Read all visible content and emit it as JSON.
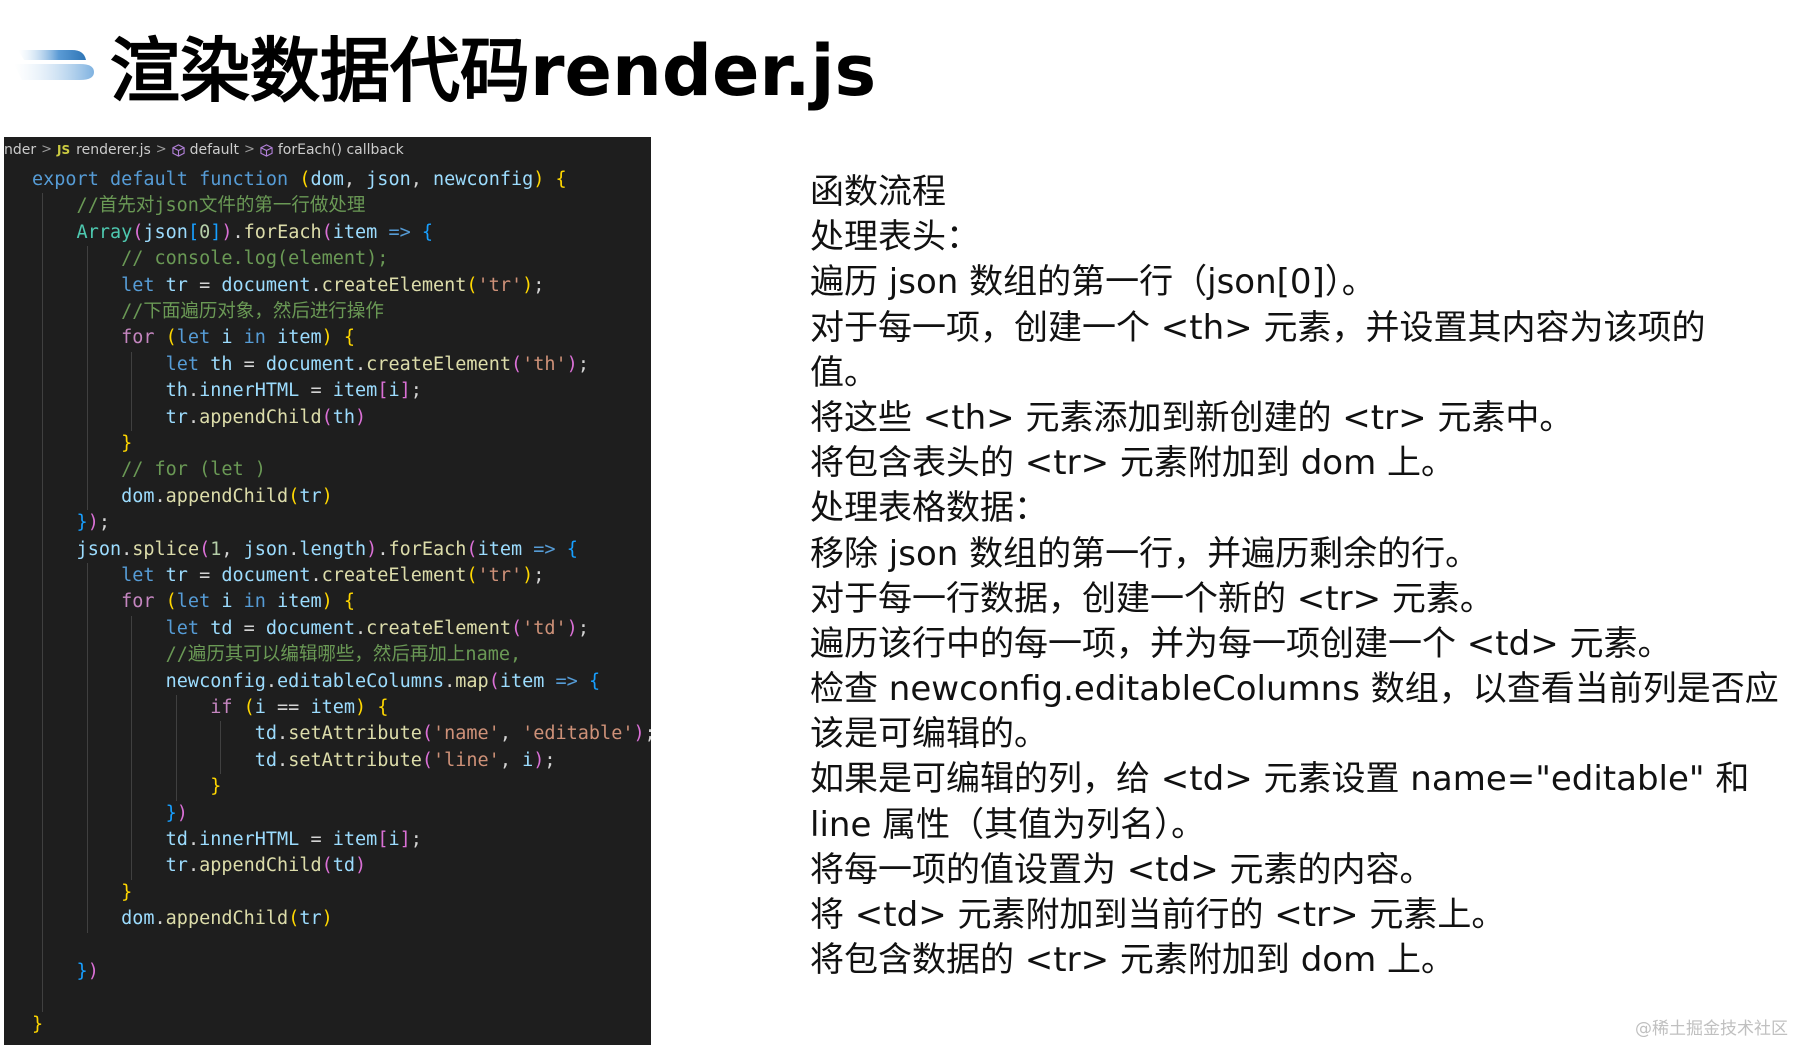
{
  "title": "渲染数据代码render.js",
  "breadcrumb": {
    "items": [
      "nder",
      "renderer.js",
      "default",
      "forEach() callback"
    ],
    "js_badge": "JS"
  },
  "code_lines": [
    [
      [
        "tk-kw",
        "export "
      ],
      [
        "tk-kw",
        "default "
      ],
      [
        "tk-kw",
        "function "
      ],
      [
        "tk-br1",
        "("
      ],
      [
        "tk-var",
        "dom"
      ],
      [
        "tk-punc",
        ", "
      ],
      [
        "tk-var",
        "json"
      ],
      [
        "tk-punc",
        ", "
      ],
      [
        "tk-var",
        "newconfig"
      ],
      [
        "tk-br1",
        ")"
      ],
      [
        "tk-punc",
        " "
      ],
      [
        "tk-br1",
        "{"
      ]
    ],
    [
      [
        "tk-com",
        "    //首先对json文件的第一行做处理"
      ]
    ],
    [
      [
        "tk-type",
        "    Array"
      ],
      [
        "tk-br2",
        "("
      ],
      [
        "tk-var",
        "json"
      ],
      [
        "tk-br3",
        "["
      ],
      [
        "tk-num",
        "0"
      ],
      [
        "tk-br3",
        "]"
      ],
      [
        "tk-br2",
        ")"
      ],
      [
        "tk-punc",
        "."
      ],
      [
        "tk-fn",
        "forEach"
      ],
      [
        "tk-br2",
        "("
      ],
      [
        "tk-var",
        "item"
      ],
      [
        "tk-kw",
        " =>"
      ],
      [
        "tk-punc",
        " "
      ],
      [
        "tk-br3",
        "{"
      ]
    ],
    [
      [
        "tk-com",
        "        // console.log(element);"
      ]
    ],
    [
      [
        "tk-kw",
        "        let "
      ],
      [
        "tk-var",
        "tr"
      ],
      [
        "tk-punc",
        " = "
      ],
      [
        "tk-var",
        "document"
      ],
      [
        "tk-punc",
        "."
      ],
      [
        "tk-fn",
        "createElement"
      ],
      [
        "tk-br1",
        "("
      ],
      [
        "tk-str",
        "'tr'"
      ],
      [
        "tk-br1",
        ")"
      ],
      [
        "tk-punc",
        ";"
      ]
    ],
    [
      [
        "tk-com",
        "        //下面遍历对象，然后进行操作"
      ]
    ],
    [
      [
        "tk-ctrl",
        "        for "
      ],
      [
        "tk-br1",
        "("
      ],
      [
        "tk-kw",
        "let "
      ],
      [
        "tk-var",
        "i"
      ],
      [
        "tk-kw",
        " in "
      ],
      [
        "tk-var",
        "item"
      ],
      [
        "tk-br1",
        ")"
      ],
      [
        "tk-punc",
        " "
      ],
      [
        "tk-br1",
        "{"
      ]
    ],
    [
      [
        "tk-kw",
        "            let "
      ],
      [
        "tk-var",
        "th"
      ],
      [
        "tk-punc",
        " = "
      ],
      [
        "tk-var",
        "document"
      ],
      [
        "tk-punc",
        "."
      ],
      [
        "tk-fn",
        "createElement"
      ],
      [
        "tk-br2",
        "("
      ],
      [
        "tk-str",
        "'th'"
      ],
      [
        "tk-br2",
        ")"
      ],
      [
        "tk-punc",
        ";"
      ]
    ],
    [
      [
        "tk-var",
        "            th"
      ],
      [
        "tk-punc",
        "."
      ],
      [
        "tk-var",
        "innerHTML"
      ],
      [
        "tk-punc",
        " = "
      ],
      [
        "tk-var",
        "item"
      ],
      [
        "tk-br2",
        "["
      ],
      [
        "tk-var",
        "i"
      ],
      [
        "tk-br2",
        "]"
      ],
      [
        "tk-punc",
        ";"
      ]
    ],
    [
      [
        "tk-var",
        "            tr"
      ],
      [
        "tk-punc",
        "."
      ],
      [
        "tk-fn",
        "appendChild"
      ],
      [
        "tk-br2",
        "("
      ],
      [
        "tk-var",
        "th"
      ],
      [
        "tk-br2",
        ")"
      ]
    ],
    [
      [
        "tk-br1",
        "        }"
      ]
    ],
    [
      [
        "tk-com",
        "        // for (let )"
      ]
    ],
    [
      [
        "tk-var",
        "        dom"
      ],
      [
        "tk-punc",
        "."
      ],
      [
        "tk-fn",
        "appendChild"
      ],
      [
        "tk-br1",
        "("
      ],
      [
        "tk-var",
        "tr"
      ],
      [
        "tk-br1",
        ")"
      ]
    ],
    [
      [
        "tk-br3",
        "    }"
      ],
      [
        "tk-br2",
        ")"
      ],
      [
        "tk-punc",
        ";"
      ]
    ],
    [
      [
        "tk-var",
        "    json"
      ],
      [
        "tk-punc",
        "."
      ],
      [
        "tk-fn",
        "splice"
      ],
      [
        "tk-br2",
        "("
      ],
      [
        "tk-num",
        "1"
      ],
      [
        "tk-punc",
        ", "
      ],
      [
        "tk-var",
        "json"
      ],
      [
        "tk-punc",
        "."
      ],
      [
        "tk-var",
        "length"
      ],
      [
        "tk-br2",
        ")"
      ],
      [
        "tk-punc",
        "."
      ],
      [
        "tk-fn",
        "forEach"
      ],
      [
        "tk-br2",
        "("
      ],
      [
        "tk-var",
        "item"
      ],
      [
        "tk-kw",
        " =>"
      ],
      [
        "tk-punc",
        " "
      ],
      [
        "tk-br3",
        "{"
      ]
    ],
    [
      [
        "tk-kw",
        "        let "
      ],
      [
        "tk-var",
        "tr"
      ],
      [
        "tk-punc",
        " = "
      ],
      [
        "tk-var",
        "document"
      ],
      [
        "tk-punc",
        "."
      ],
      [
        "tk-fn",
        "createElement"
      ],
      [
        "tk-br1",
        "("
      ],
      [
        "tk-str",
        "'tr'"
      ],
      [
        "tk-br1",
        ")"
      ],
      [
        "tk-punc",
        ";"
      ]
    ],
    [
      [
        "tk-ctrl",
        "        for "
      ],
      [
        "tk-br1",
        "("
      ],
      [
        "tk-kw",
        "let "
      ],
      [
        "tk-var",
        "i"
      ],
      [
        "tk-kw",
        " in "
      ],
      [
        "tk-var",
        "item"
      ],
      [
        "tk-br1",
        ")"
      ],
      [
        "tk-punc",
        " "
      ],
      [
        "tk-br1",
        "{"
      ]
    ],
    [
      [
        "tk-kw",
        "            let "
      ],
      [
        "tk-var",
        "td"
      ],
      [
        "tk-punc",
        " = "
      ],
      [
        "tk-var",
        "document"
      ],
      [
        "tk-punc",
        "."
      ],
      [
        "tk-fn",
        "createElement"
      ],
      [
        "tk-br2",
        "("
      ],
      [
        "tk-str",
        "'td'"
      ],
      [
        "tk-br2",
        ")"
      ],
      [
        "tk-punc",
        ";"
      ]
    ],
    [
      [
        "tk-com",
        "            //遍历其可以编辑哪些，然后再加上name,"
      ]
    ],
    [
      [
        "tk-var",
        "            newconfig"
      ],
      [
        "tk-punc",
        "."
      ],
      [
        "tk-var",
        "editableColumns"
      ],
      [
        "tk-punc",
        "."
      ],
      [
        "tk-fn",
        "map"
      ],
      [
        "tk-br2",
        "("
      ],
      [
        "tk-var",
        "item"
      ],
      [
        "tk-kw",
        " =>"
      ],
      [
        "tk-punc",
        " "
      ],
      [
        "tk-br3",
        "{"
      ]
    ],
    [
      [
        "tk-ctrl",
        "                if "
      ],
      [
        "tk-br1",
        "("
      ],
      [
        "tk-var",
        "i"
      ],
      [
        "tk-punc",
        " == "
      ],
      [
        "tk-var",
        "item"
      ],
      [
        "tk-br1",
        ")"
      ],
      [
        "tk-punc",
        " "
      ],
      [
        "tk-br1",
        "{"
      ]
    ],
    [
      [
        "tk-var",
        "                    td"
      ],
      [
        "tk-punc",
        "."
      ],
      [
        "tk-fn",
        "setAttribute"
      ],
      [
        "tk-br2",
        "("
      ],
      [
        "tk-str",
        "'name'"
      ],
      [
        "tk-punc",
        ", "
      ],
      [
        "tk-str",
        "'editable'"
      ],
      [
        "tk-br2",
        ")"
      ],
      [
        "tk-punc",
        ";"
      ]
    ],
    [
      [
        "tk-var",
        "                    td"
      ],
      [
        "tk-punc",
        "."
      ],
      [
        "tk-fn",
        "setAttribute"
      ],
      [
        "tk-br2",
        "("
      ],
      [
        "tk-str",
        "'line'"
      ],
      [
        "tk-punc",
        ", "
      ],
      [
        "tk-var",
        "i"
      ],
      [
        "tk-br2",
        ")"
      ],
      [
        "tk-punc",
        ";"
      ]
    ],
    [
      [
        "tk-br1",
        "                }"
      ]
    ],
    [
      [
        "tk-br3",
        "            }"
      ],
      [
        "tk-br2",
        ")"
      ]
    ],
    [
      [
        "tk-var",
        "            td"
      ],
      [
        "tk-punc",
        "."
      ],
      [
        "tk-var",
        "innerHTML"
      ],
      [
        "tk-punc",
        " = "
      ],
      [
        "tk-var",
        "item"
      ],
      [
        "tk-br2",
        "["
      ],
      [
        "tk-var",
        "i"
      ],
      [
        "tk-br2",
        "]"
      ],
      [
        "tk-punc",
        ";"
      ]
    ],
    [
      [
        "tk-var",
        "            tr"
      ],
      [
        "tk-punc",
        "."
      ],
      [
        "tk-fn",
        "appendChild"
      ],
      [
        "tk-br2",
        "("
      ],
      [
        "tk-var",
        "td"
      ],
      [
        "tk-br2",
        ")"
      ]
    ],
    [
      [
        "tk-br1",
        "        }"
      ]
    ],
    [
      [
        "tk-var",
        "        dom"
      ],
      [
        "tk-punc",
        "."
      ],
      [
        "tk-fn",
        "appendChild"
      ],
      [
        "tk-br1",
        "("
      ],
      [
        "tk-var",
        "tr"
      ],
      [
        "tk-br1",
        ")"
      ]
    ],
    [],
    [
      [
        "tk-br3",
        "    }"
      ],
      [
        "tk-br2",
        ")"
      ]
    ],
    [],
    [
      [
        "tk-br1",
        "}"
      ]
    ]
  ],
  "description": [
    "函数流程",
    "处理表头：",
    "遍历 json 数组的第一行（json[0]）。",
    "对于每一项，创建一个 <th> 元素，并设置其内容为该项的",
    "值。",
    "将这些 <th> 元素添加到新创建的 <tr> 元素中。",
    "将包含表头的 <tr> 元素附加到 dom 上。",
    "处理表格数据：",
    "移除 json 数组的第一行，并遍历剩余的行。",
    "对于每一行数据，创建一个新的 <tr> 元素。",
    "遍历该行中的每一项，并为每一项创建一个 <td> 元素。",
    "检查 newconfig.editableColumns 数组，以查看当前列是否应",
    "该是可编辑的。",
    "如果是可编辑的列，给 <td> 元素设置 name=\"editable\" 和",
    "line 属性（其值为列名）。",
    "将每一项的值设置为 <td> 元素的内容。",
    "将 <td> 元素附加到当前行的 <tr> 元素上。",
    "将包含数据的 <tr> 元素附加到 dom 上。"
  ],
  "watermark": "@稀土掘金技术社区"
}
